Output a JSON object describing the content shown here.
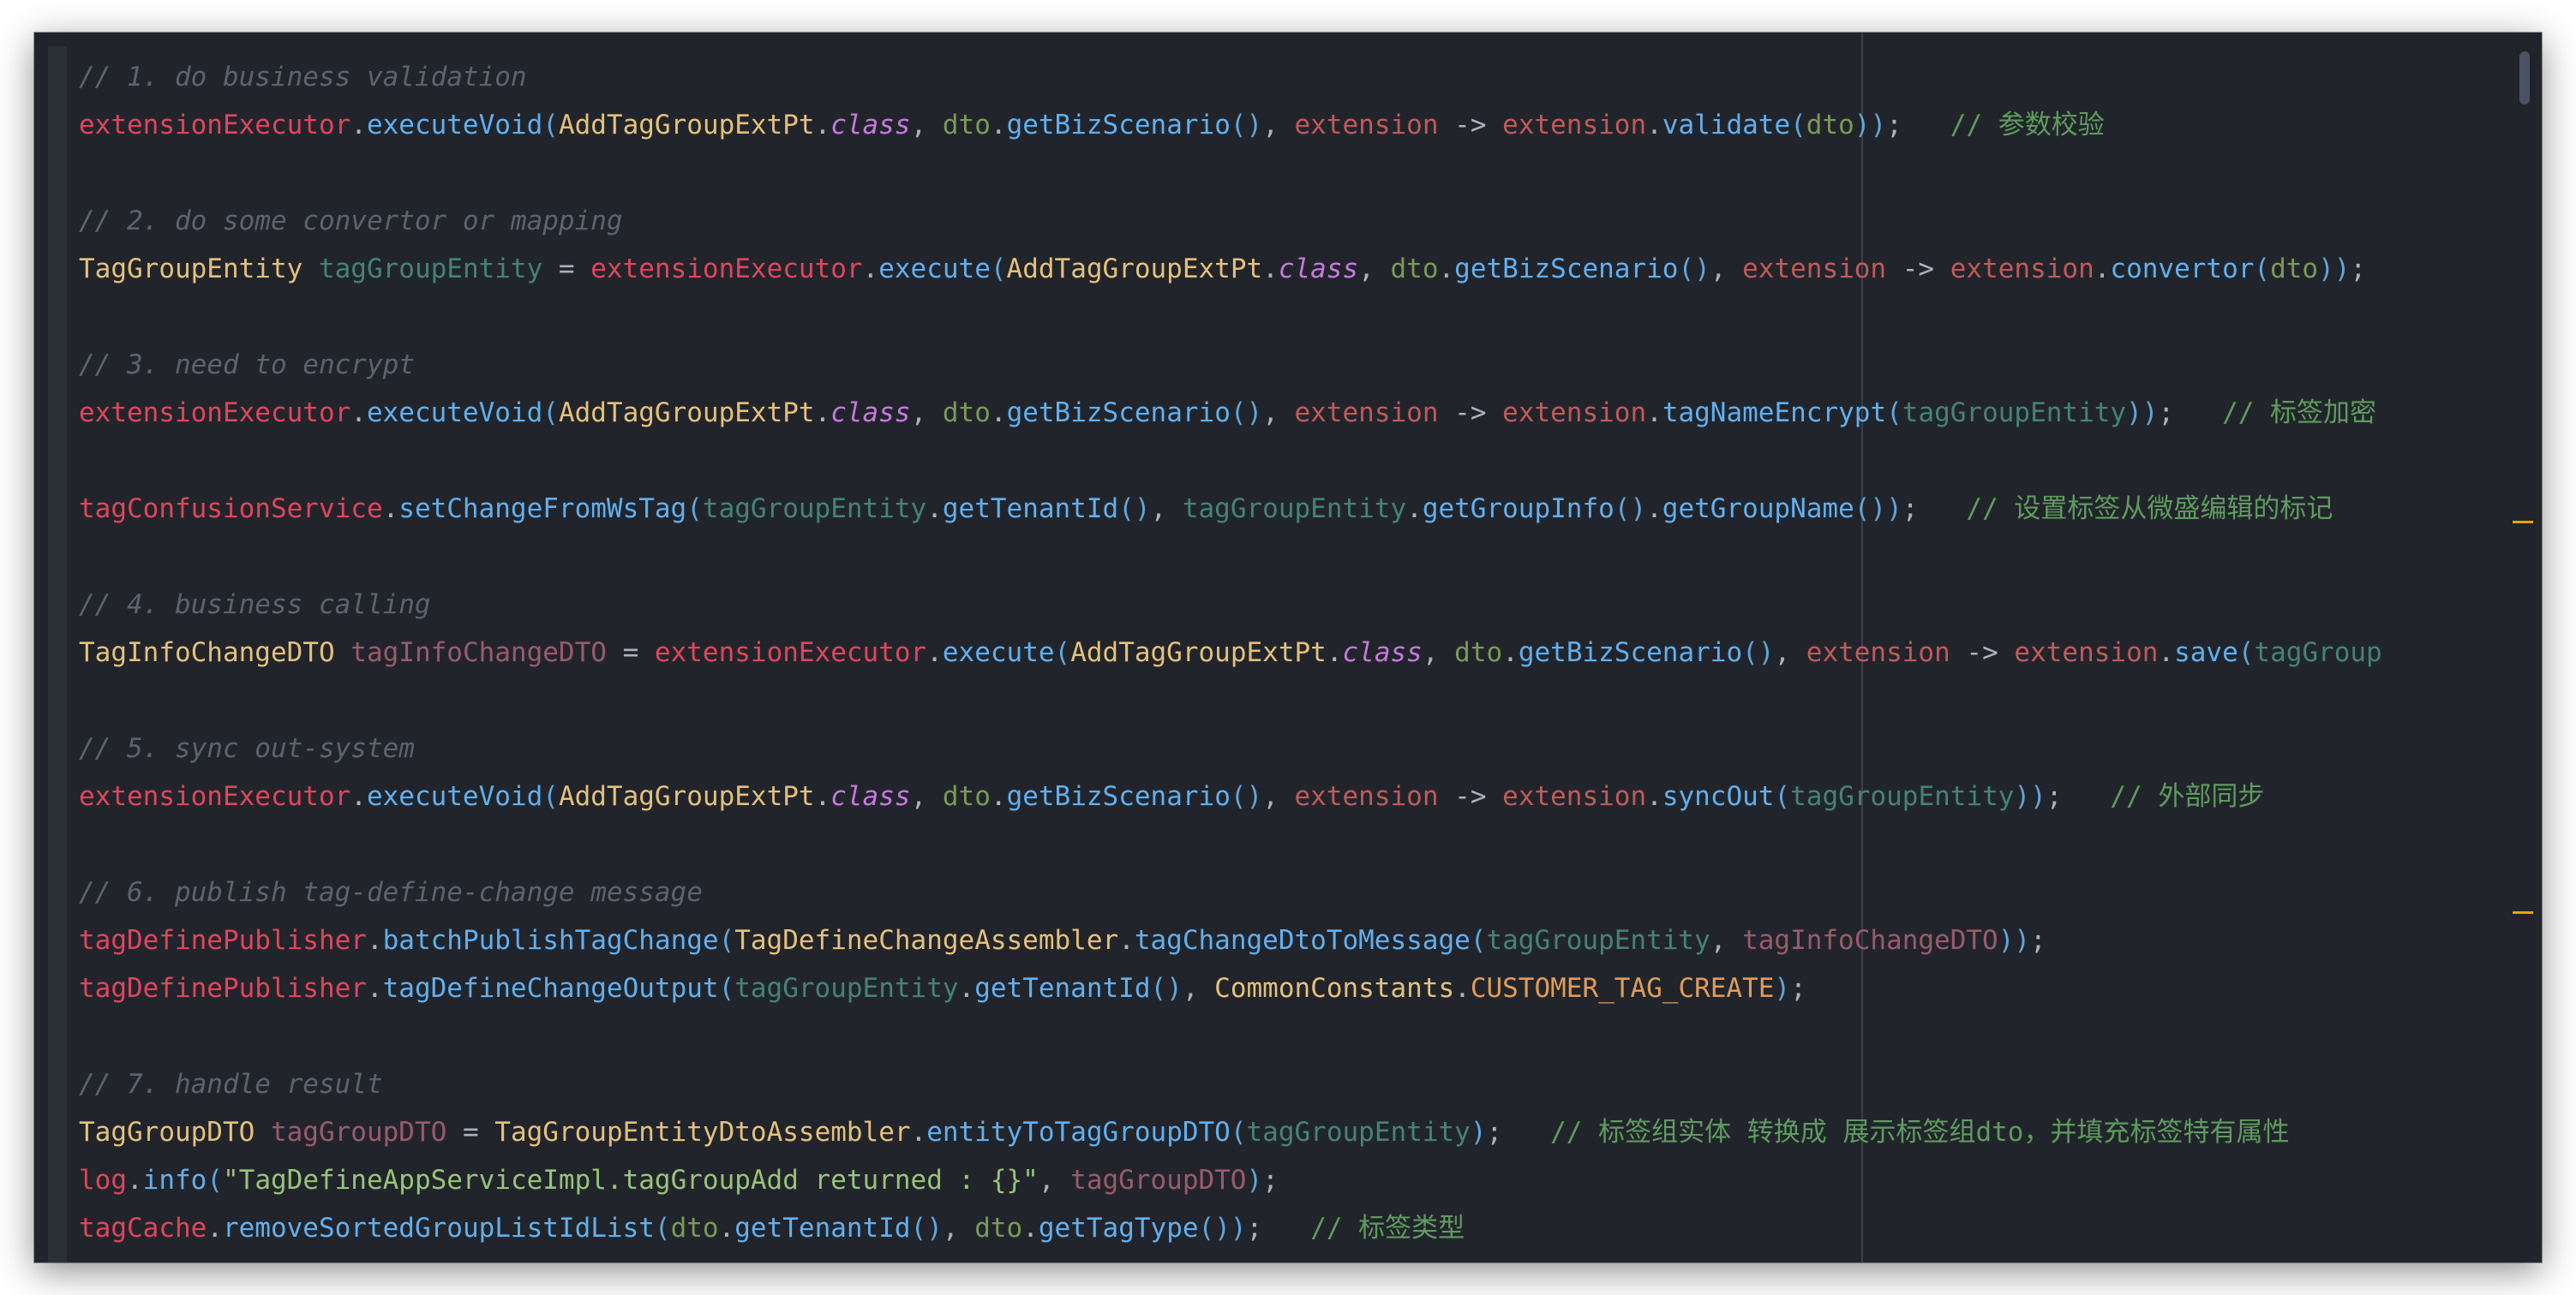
{
  "editor": {
    "accent_colors": {
      "background": "#21252b",
      "comment": "#5c6370",
      "method": "#61afef",
      "type": "#e5c07b",
      "keyword": "#c678dd",
      "field": "#e0455c",
      "string": "#98c379",
      "constant": "#e09c57",
      "gutter_marker": "#e5a50a"
    },
    "lines": [
      [
        {
          "t": "// 1. do business validation",
          "c": "comment"
        }
      ],
      [
        {
          "t": "extensionExecutor",
          "c": "red"
        },
        {
          "t": ".",
          "c": "punc"
        },
        {
          "t": "executeVoid",
          "c": "fn"
        },
        {
          "t": "(",
          "c": "paren"
        },
        {
          "t": "AddTagGroupExtPt",
          "c": "cls"
        },
        {
          "t": ".",
          "c": "punc"
        },
        {
          "t": "class",
          "c": "kw"
        },
        {
          "t": ", ",
          "c": "punc"
        },
        {
          "t": "dto",
          "c": "green"
        },
        {
          "t": ".",
          "c": "punc"
        },
        {
          "t": "getBizScenario",
          "c": "fn"
        },
        {
          "t": "()",
          "c": "paren"
        },
        {
          "t": ", ",
          "c": "punc"
        },
        {
          "t": "extension",
          "c": "param"
        },
        {
          "t": " -> ",
          "c": "punc"
        },
        {
          "t": "extension",
          "c": "param"
        },
        {
          "t": ".",
          "c": "punc"
        },
        {
          "t": "validate",
          "c": "fn"
        },
        {
          "t": "(",
          "c": "paren"
        },
        {
          "t": "dto",
          "c": "green"
        },
        {
          "t": "))",
          "c": "paren"
        },
        {
          "t": ";   ",
          "c": "punc"
        },
        {
          "t": "// 参数校验",
          "c": "zh"
        }
      ],
      [],
      [
        {
          "t": "// 2. do some convertor or mapping",
          "c": "comment"
        }
      ],
      [
        {
          "t": "TagGroupEntity",
          "c": "cls"
        },
        {
          "t": " ",
          "c": "punc"
        },
        {
          "t": "tagGroupEntity",
          "c": "teal"
        },
        {
          "t": " = ",
          "c": "punc"
        },
        {
          "t": "extensionExecutor",
          "c": "red"
        },
        {
          "t": ".",
          "c": "punc"
        },
        {
          "t": "execute",
          "c": "fn"
        },
        {
          "t": "(",
          "c": "paren"
        },
        {
          "t": "AddTagGroupExtPt",
          "c": "cls"
        },
        {
          "t": ".",
          "c": "punc"
        },
        {
          "t": "class",
          "c": "kw"
        },
        {
          "t": ", ",
          "c": "punc"
        },
        {
          "t": "dto",
          "c": "green"
        },
        {
          "t": ".",
          "c": "punc"
        },
        {
          "t": "getBizScenario",
          "c": "fn"
        },
        {
          "t": "()",
          "c": "paren"
        },
        {
          "t": ", ",
          "c": "punc"
        },
        {
          "t": "extension",
          "c": "param"
        },
        {
          "t": " -> ",
          "c": "punc"
        },
        {
          "t": "extension",
          "c": "param"
        },
        {
          "t": ".",
          "c": "punc"
        },
        {
          "t": "convertor",
          "c": "fn"
        },
        {
          "t": "(",
          "c": "paren"
        },
        {
          "t": "dto",
          "c": "green"
        },
        {
          "t": "))",
          "c": "paren"
        },
        {
          "t": ";",
          "c": "punc"
        }
      ],
      [],
      [
        {
          "t": "// 3. need to encrypt",
          "c": "comment"
        }
      ],
      [
        {
          "t": "extensionExecutor",
          "c": "red"
        },
        {
          "t": ".",
          "c": "punc"
        },
        {
          "t": "executeVoid",
          "c": "fn"
        },
        {
          "t": "(",
          "c": "paren"
        },
        {
          "t": "AddTagGroupExtPt",
          "c": "cls"
        },
        {
          "t": ".",
          "c": "punc"
        },
        {
          "t": "class",
          "c": "kw"
        },
        {
          "t": ", ",
          "c": "punc"
        },
        {
          "t": "dto",
          "c": "green"
        },
        {
          "t": ".",
          "c": "punc"
        },
        {
          "t": "getBizScenario",
          "c": "fn"
        },
        {
          "t": "()",
          "c": "paren"
        },
        {
          "t": ", ",
          "c": "punc"
        },
        {
          "t": "extension",
          "c": "param"
        },
        {
          "t": " -> ",
          "c": "punc"
        },
        {
          "t": "extension",
          "c": "param"
        },
        {
          "t": ".",
          "c": "punc"
        },
        {
          "t": "tagNameEncrypt",
          "c": "fn"
        },
        {
          "t": "(",
          "c": "paren"
        },
        {
          "t": "tagGroupEntity",
          "c": "teal"
        },
        {
          "t": "))",
          "c": "paren"
        },
        {
          "t": ";   ",
          "c": "punc"
        },
        {
          "t": "// 标签加密",
          "c": "zh"
        }
      ],
      [],
      [
        {
          "t": "tagConfusionService",
          "c": "red"
        },
        {
          "t": ".",
          "c": "punc"
        },
        {
          "t": "setChangeFromWsTag",
          "c": "fn"
        },
        {
          "t": "(",
          "c": "paren"
        },
        {
          "t": "tagGroupEntity",
          "c": "teal"
        },
        {
          "t": ".",
          "c": "punc"
        },
        {
          "t": "getTenantId",
          "c": "fn"
        },
        {
          "t": "()",
          "c": "paren"
        },
        {
          "t": ", ",
          "c": "punc"
        },
        {
          "t": "tagGroupEntity",
          "c": "teal"
        },
        {
          "t": ".",
          "c": "punc"
        },
        {
          "t": "getGroupInfo",
          "c": "fn"
        },
        {
          "t": "()",
          "c": "paren"
        },
        {
          "t": ".",
          "c": "punc"
        },
        {
          "t": "getGroupName",
          "c": "fn"
        },
        {
          "t": "())",
          "c": "paren"
        },
        {
          "t": ";   ",
          "c": "punc"
        },
        {
          "t": "// 设置标签从微盛编辑的标记",
          "c": "zh"
        }
      ],
      [],
      [
        {
          "t": "// 4. business calling",
          "c": "comment"
        }
      ],
      [
        {
          "t": "TagInfoChangeDTO",
          "c": "cls"
        },
        {
          "t": " ",
          "c": "punc"
        },
        {
          "t": "tagInfoChangeDTO",
          "c": "dto"
        },
        {
          "t": " = ",
          "c": "punc"
        },
        {
          "t": "extensionExecutor",
          "c": "red"
        },
        {
          "t": ".",
          "c": "punc"
        },
        {
          "t": "execute",
          "c": "fn"
        },
        {
          "t": "(",
          "c": "paren"
        },
        {
          "t": "AddTagGroupExtPt",
          "c": "cls"
        },
        {
          "t": ".",
          "c": "punc"
        },
        {
          "t": "class",
          "c": "kw"
        },
        {
          "t": ", ",
          "c": "punc"
        },
        {
          "t": "dto",
          "c": "green"
        },
        {
          "t": ".",
          "c": "punc"
        },
        {
          "t": "getBizScenario",
          "c": "fn"
        },
        {
          "t": "()",
          "c": "paren"
        },
        {
          "t": ", ",
          "c": "punc"
        },
        {
          "t": "extension",
          "c": "param"
        },
        {
          "t": " -> ",
          "c": "punc"
        },
        {
          "t": "extension",
          "c": "param"
        },
        {
          "t": ".",
          "c": "punc"
        },
        {
          "t": "save",
          "c": "fn"
        },
        {
          "t": "(",
          "c": "paren"
        },
        {
          "t": "tagGroup",
          "c": "teal"
        }
      ],
      [],
      [
        {
          "t": "// 5. sync out-system",
          "c": "comment"
        }
      ],
      [
        {
          "t": "extensionExecutor",
          "c": "red"
        },
        {
          "t": ".",
          "c": "punc"
        },
        {
          "t": "executeVoid",
          "c": "fn"
        },
        {
          "t": "(",
          "c": "paren"
        },
        {
          "t": "AddTagGroupExtPt",
          "c": "cls"
        },
        {
          "t": ".",
          "c": "punc"
        },
        {
          "t": "class",
          "c": "kw"
        },
        {
          "t": ", ",
          "c": "punc"
        },
        {
          "t": "dto",
          "c": "green"
        },
        {
          "t": ".",
          "c": "punc"
        },
        {
          "t": "getBizScenario",
          "c": "fn"
        },
        {
          "t": "()",
          "c": "paren"
        },
        {
          "t": ", ",
          "c": "punc"
        },
        {
          "t": "extension",
          "c": "param"
        },
        {
          "t": " -> ",
          "c": "punc"
        },
        {
          "t": "extension",
          "c": "param"
        },
        {
          "t": ".",
          "c": "punc"
        },
        {
          "t": "syncOut",
          "c": "fn"
        },
        {
          "t": "(",
          "c": "paren"
        },
        {
          "t": "tagGroupEntity",
          "c": "teal"
        },
        {
          "t": "))",
          "c": "paren"
        },
        {
          "t": ";   ",
          "c": "punc"
        },
        {
          "t": "// 外部同步",
          "c": "zh"
        }
      ],
      [],
      [
        {
          "t": "// 6. publish tag-define-change message",
          "c": "comment"
        }
      ],
      [
        {
          "t": "tagDefinePublisher",
          "c": "red"
        },
        {
          "t": ".",
          "c": "punc"
        },
        {
          "t": "batchPublishTagChange",
          "c": "fn"
        },
        {
          "t": "(",
          "c": "paren"
        },
        {
          "t": "TagDefineChangeAssembler",
          "c": "cls"
        },
        {
          "t": ".",
          "c": "punc"
        },
        {
          "t": "tagChangeDtoToMessage",
          "c": "fn"
        },
        {
          "t": "(",
          "c": "paren"
        },
        {
          "t": "tagGroupEntity",
          "c": "teal"
        },
        {
          "t": ", ",
          "c": "punc"
        },
        {
          "t": "tagInfoChangeDTO",
          "c": "dto"
        },
        {
          "t": "))",
          "c": "paren"
        },
        {
          "t": ";",
          "c": "punc"
        }
      ],
      [
        {
          "t": "tagDefinePublisher",
          "c": "red"
        },
        {
          "t": ".",
          "c": "punc"
        },
        {
          "t": "tagDefineChangeOutput",
          "c": "fn"
        },
        {
          "t": "(",
          "c": "paren"
        },
        {
          "t": "tagGroupEntity",
          "c": "teal"
        },
        {
          "t": ".",
          "c": "punc"
        },
        {
          "t": "getTenantId",
          "c": "fn"
        },
        {
          "t": "()",
          "c": "paren"
        },
        {
          "t": ", ",
          "c": "punc"
        },
        {
          "t": "CommonConstants",
          "c": "cls"
        },
        {
          "t": ".",
          "c": "punc"
        },
        {
          "t": "CUSTOMER_TAG_CREATE",
          "c": "const"
        },
        {
          "t": ")",
          "c": "paren"
        },
        {
          "t": ";",
          "c": "punc"
        }
      ],
      [],
      [
        {
          "t": "// 7. handle result",
          "c": "comment"
        }
      ],
      [
        {
          "t": "TagGroupDTO",
          "c": "cls"
        },
        {
          "t": " ",
          "c": "punc"
        },
        {
          "t": "tagGroupDTO",
          "c": "var"
        },
        {
          "t": " = ",
          "c": "punc"
        },
        {
          "t": "TagGroupEntityDtoAssembler",
          "c": "cls"
        },
        {
          "t": ".",
          "c": "punc"
        },
        {
          "t": "entityToTagGroupDTO",
          "c": "fn"
        },
        {
          "t": "(",
          "c": "paren"
        },
        {
          "t": "tagGroupEntity",
          "c": "teal"
        },
        {
          "t": ")",
          "c": "paren"
        },
        {
          "t": ";   ",
          "c": "punc"
        },
        {
          "t": "// 标签组实体 转换成 展示标签组dto，并填充标签特有属性",
          "c": "zh"
        }
      ],
      [
        {
          "t": "log",
          "c": "red"
        },
        {
          "t": ".",
          "c": "punc"
        },
        {
          "t": "info",
          "c": "fn"
        },
        {
          "t": "(",
          "c": "paren"
        },
        {
          "t": "\"TagDefineAppServiceImpl.tagGroupAdd returned : {}\"",
          "c": "str"
        },
        {
          "t": ", ",
          "c": "punc"
        },
        {
          "t": "tagGroupDTO",
          "c": "var"
        },
        {
          "t": ")",
          "c": "paren"
        },
        {
          "t": ";",
          "c": "punc"
        }
      ],
      [
        {
          "t": "tagCache",
          "c": "red"
        },
        {
          "t": ".",
          "c": "punc"
        },
        {
          "t": "removeSortedGroupListIdList",
          "c": "fn"
        },
        {
          "t": "(",
          "c": "paren"
        },
        {
          "t": "dto",
          "c": "green"
        },
        {
          "t": ".",
          "c": "punc"
        },
        {
          "t": "getTenantId",
          "c": "fn"
        },
        {
          "t": "()",
          "c": "paren"
        },
        {
          "t": ", ",
          "c": "punc"
        },
        {
          "t": "dto",
          "c": "green"
        },
        {
          "t": ".",
          "c": "punc"
        },
        {
          "t": "getTagType",
          "c": "fn"
        },
        {
          "t": "())",
          "c": "paren"
        },
        {
          "t": ";   ",
          "c": "punc"
        },
        {
          "t": "// 标签类型",
          "c": "zh"
        }
      ]
    ]
  }
}
